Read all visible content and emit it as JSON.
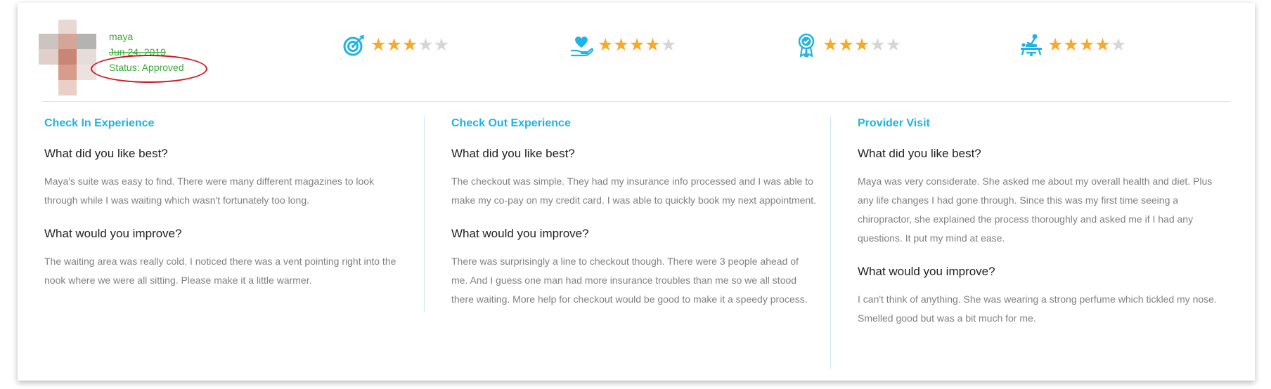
{
  "user": {
    "name": "maya",
    "date": "Jun 24, 2019",
    "status": "Status: Approved"
  },
  "ratings": [
    {
      "icon": "target-icon",
      "stars": 3,
      "max": 5
    },
    {
      "icon": "heart-hand-icon",
      "stars": 4,
      "max": 5
    },
    {
      "icon": "award-ribbon-icon",
      "stars": 3,
      "max": 5
    },
    {
      "icon": "massage-table-icon",
      "stars": 4,
      "max": 5
    }
  ],
  "colors": {
    "accent": "#1fb3e6",
    "star_on": "#f6a92b",
    "star_off": "#d6d6d6",
    "status_green": "#3aaa35",
    "annotation_red": "#d0141b"
  },
  "sections": [
    {
      "title": "Check In Experience",
      "q1": "What did you like best?",
      "a1": "Maya's suite was easy to find. There were many different magazines to look through while I was waiting which wasn't fortunately too long.",
      "q2": "What would you improve?",
      "a2": "The waiting area was really cold. I noticed there was a vent pointing right into the nook where we were all sitting. Please make it a little warmer."
    },
    {
      "title": "Check Out Experience",
      "q1": "What did you like best?",
      "a1": "The checkout was simple. They had my insurance info processed and I was able to make my co-pay on my credit card. I was able to quickly book my next appointment.",
      "q2": "What would you improve?",
      "a2": "There was surprisingly a line to checkout though. There were 3 people ahead of me. And I guess one man had more insurance troubles than me so we all stood there waiting. More help for checkout would be good to make it a speedy process."
    },
    {
      "title": "Provider Visit",
      "q1": "What did you like best?",
      "a1": "Maya was very considerate. She asked me about my overall health and diet. Plus any life changes I had gone through. Since this was my first time seeing a chiropractor, she explained the process thoroughly and asked me if I had any questions. It put my mind at ease.",
      "q2": "What would you improve?",
      "a2": "I can't think of anything. She was wearing a strong perfume which tickled my nose. Smelled good but was a bit much for me."
    }
  ]
}
